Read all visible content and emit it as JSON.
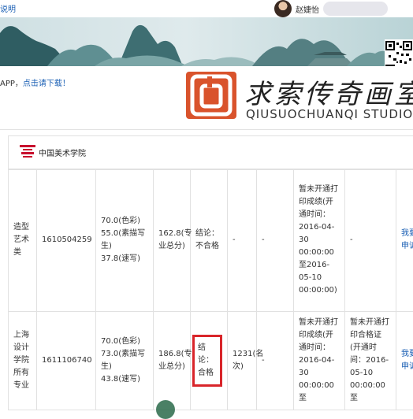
{
  "topbar": {
    "help_text": "说明",
    "user_name": "赵婕怡"
  },
  "app_strip": {
    "text": "APP，",
    "link": "点击请下载！"
  },
  "studio": {
    "name_cn": "求索传奇画室",
    "name_en": "QIUSUOCHUANQI STUDIO"
  },
  "school": {
    "name": "中国美术学院"
  },
  "rows": [
    {
      "major": "造型艺术类",
      "exam_no": "1610504259",
      "scores": [
        "70.0(色彩)",
        "55.0(素描写生)",
        "37.8(速写)"
      ],
      "total": "162.8(专业总分)",
      "result": "结论：不合格",
      "rank": "-",
      "col6": "-",
      "print_score": "暂未开通打印成绩(开通时间：2016-04-30 00:00:00至2016-05-10 00:00:00)",
      "print_cert": "-",
      "appeal": "我要申诉"
    },
    {
      "major": "上海设计学院所有专业",
      "exam_no": "1611106740",
      "scores": [
        "70.0(色彩)",
        "73.0(素描写生)",
        "43.8(速写)"
      ],
      "total": "186.8(专业总分)",
      "result": "结论：合格",
      "rank": "1231(名次)",
      "col6": "-",
      "print_score": "暂未开通打印成绩(开通时间：2016-04-30 00:00:00至",
      "print_cert": "暂未开通打印合格证(开通时间：2016-05-10 00:00:00至",
      "appeal": "我要申诉"
    }
  ],
  "colors": {
    "link": "#1a5fb4",
    "highlight": "#d9252a",
    "logo": "#d9532c"
  }
}
